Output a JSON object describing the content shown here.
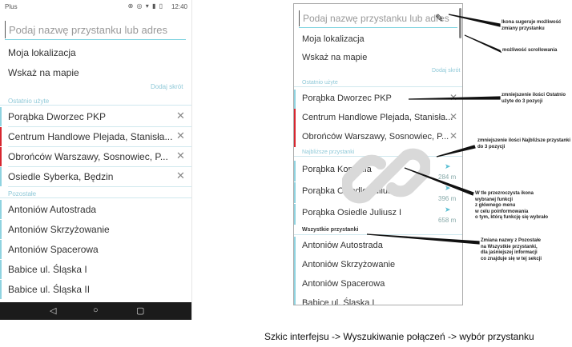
{
  "left": {
    "status": {
      "carrier": "Plus",
      "icons": "⊗ ◎ ▾ ▮ ▯",
      "time": "12:40"
    },
    "search": {
      "placeholder": "Podaj nazwę przystanku lub adres"
    },
    "menu": [
      "Moja lokalizacja",
      "Wskaż na mapie"
    ],
    "add_shortcut": "Dodaj skrót",
    "section_recent": "Ostatnio użyte",
    "recent": [
      {
        "name": "Porąbka Dworzec PKP",
        "bar": "#8fd3e0"
      },
      {
        "name": "Centrum Handlowe Plejada, Stanisła...",
        "bar": "#d7262f"
      },
      {
        "name": "Obrońców Warszawy, Sosnowiec, P...",
        "bar": "#d7262f"
      },
      {
        "name": "Osiedle Syberka, Będzin",
        "bar": "#8fd3e0"
      }
    ],
    "section_other": "Pozostałe",
    "other": [
      "Antoniów Autostrada",
      "Antoniów Skrzyżowanie",
      "Antoniów Spacerowa",
      "Babice ul. Śląska I",
      "Babice ul. Śląska II"
    ],
    "nav": {
      "back": "◁",
      "home": "○",
      "recent": "▢"
    }
  },
  "right": {
    "search": {
      "placeholder": "Podaj nazwę przystanku lub adres"
    },
    "menu": [
      "Moja lokalizacja",
      "Wskaż na mapie"
    ],
    "add_shortcut": "Dodaj skrót",
    "section_recent": "Ostatnio użyte",
    "recent": [
      {
        "name": "Porąbka Dworzec PKP",
        "bar": "#8fd3e0"
      },
      {
        "name": "Centrum Handlowe Plejada, Stanisła...",
        "bar": "#d7262f"
      },
      {
        "name": "Obrońców Warszawy, Sosnowiec, P...",
        "bar": "#d7262f"
      }
    ],
    "section_nearest": "Najbliższe przystanki",
    "nearest": [
      {
        "name": "Porąbka Kopalnia",
        "dist": "284 m"
      },
      {
        "name": "Porąbka Osiedle Juliusz II",
        "dist": "396 m"
      },
      {
        "name": "Porąbka Osiedle Juliusz I",
        "dist": "658 m"
      }
    ],
    "section_all": "Wszystkie przystanki",
    "all": [
      "Antoniów Autostrada",
      "Antoniów Skrzyżowanie",
      "Antoniów Spacerowa",
      "Babice ul. Śląska I"
    ]
  },
  "annotations": {
    "a1": "Ikona sugeruje możliwość\nzmiany przystanku",
    "a2": "możliwość scrollowania",
    "a3": "zmniejszenie ilości Ostatnio\nużyte do 3 pozycji",
    "a4": "zmniejszenie ilości Najbliższe przystanki\ndo 3 pozycji",
    "a5": "W tle przezroczysta ikona\nwybranej funkcji\nz głównego menu\nw celu poinformowania\no tym, którą funkcję się wybrało",
    "a6": "Zmiana nazwy z Pozostałe\nna Wszystkie przystanki,\ndla jaśniejszej informacji\nco znajduje się w tej sekcji"
  },
  "caption": "Szkic interfejsu -> Wyszukiwanie połączeń -> wybór przystanku",
  "colors": {
    "accent": "#8fd3e0",
    "red": "#d7262f"
  }
}
